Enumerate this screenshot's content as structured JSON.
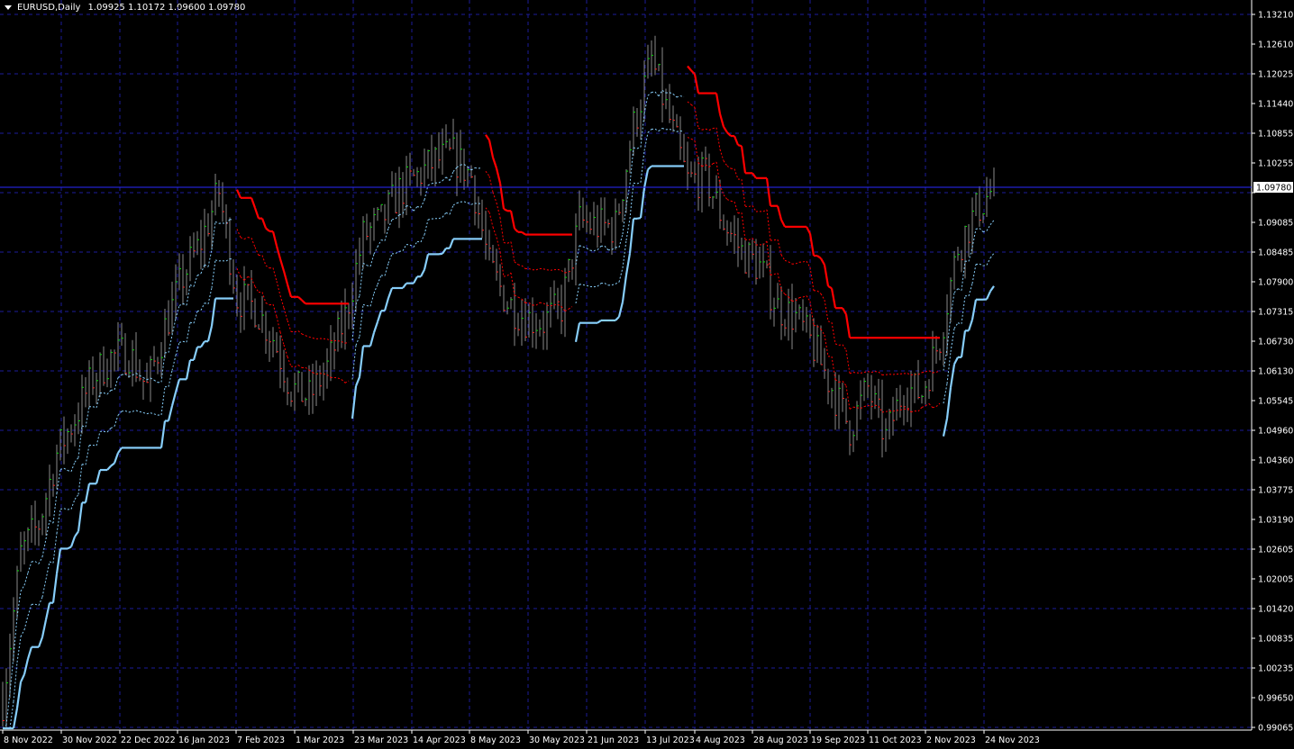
{
  "header": {
    "symbol": "EURUSD,Daily",
    "ohlc": "1.09925 1.10172 1.09600 1.09780"
  },
  "colors": {
    "background": "#000000",
    "grid": "#1c1c9a",
    "bull_bar": "#00e000",
    "bear_bar": "#ff2020",
    "stop_up": "#87cefa",
    "stop_down": "#ff0000",
    "price_line": "#2a2aff",
    "axis": "#ffffff"
  },
  "chart_data": {
    "type": "ohlc",
    "symbol": "EURUSD",
    "timeframe": "Daily",
    "last_price": "1.09780",
    "ylim": [
      0.99065,
      1.1321
    ],
    "grid": true,
    "y_ticks": [
      "1.13210",
      "1.12610",
      "1.12025",
      "1.11440",
      "1.10855",
      "1.10255",
      "1.09670",
      "1.09085",
      "1.08485",
      "1.07900",
      "1.07315",
      "1.06730",
      "1.06130",
      "1.05545",
      "1.04960",
      "1.04360",
      "1.03775",
      "1.03190",
      "1.02605",
      "1.02005",
      "1.01420",
      "1.00835",
      "1.00235",
      "0.99650",
      "0.99065"
    ],
    "x_ticks": [
      "8 Nov 2022",
      "30 Nov 2022",
      "22 Dec 2022",
      "16 Jan 2023",
      "7 Feb 2023",
      "1 Mar 2023",
      "23 Mar 2023",
      "14 Apr 2023",
      "8 May 2023",
      "30 May 2023",
      "21 Jun 2023",
      "13 Jul 2023",
      "4 Aug 2023",
      "28 Aug 2023",
      "19 Sep 2023",
      "11 Oct 2023",
      "2 Nov 2023",
      "24 Nov 2023"
    ],
    "weekly_closes": [
      0.996,
      1.025,
      1.031,
      1.045,
      1.052,
      1.06,
      1.064,
      1.065,
      1.058,
      1.07,
      1.08,
      1.087,
      1.097,
      1.076,
      1.074,
      1.068,
      1.058,
      1.056,
      1.062,
      1.072,
      1.088,
      1.091,
      1.097,
      1.1,
      1.103,
      1.104,
      1.1,
      1.082,
      1.075,
      1.072,
      1.071,
      1.074,
      1.091,
      1.09,
      1.09,
      1.11,
      1.123,
      1.111,
      1.099,
      1.1,
      1.091,
      1.085,
      1.082,
      1.074,
      1.072,
      1.066,
      1.058,
      1.05,
      1.058,
      1.048,
      1.058,
      1.057,
      1.068,
      1.086,
      1.093,
      1.0978
    ]
  }
}
